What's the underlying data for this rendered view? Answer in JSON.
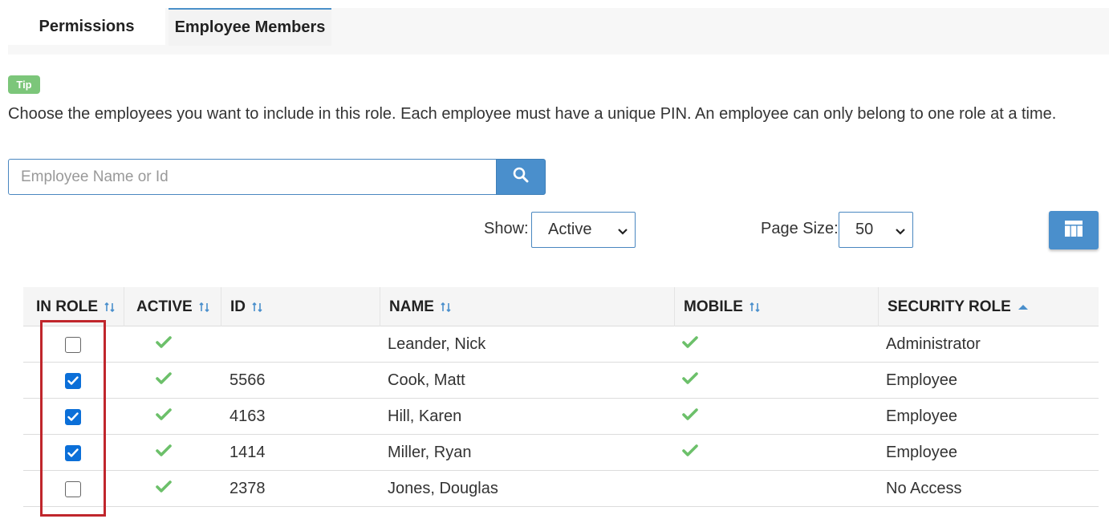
{
  "tabs": [
    {
      "label": "Permissions"
    },
    {
      "label": "Employee Members"
    }
  ],
  "tip": {
    "badge": "Tip",
    "text": "Choose the employees you want to include in this role. Each employee must have a unique PIN. An employee can only belong to one role at a time."
  },
  "search": {
    "placeholder": "Employee Name or Id",
    "value": "",
    "icon": "search-icon"
  },
  "filters": {
    "show_label": "Show:",
    "show_value": "Active",
    "page_size_label": "Page Size:",
    "page_size_value": "50"
  },
  "columns_button_icon": "grid-columns-icon",
  "table": {
    "headers": [
      "IN ROLE",
      "ACTIVE",
      "ID",
      "NAME",
      "MOBILE",
      "SECURITY ROLE"
    ],
    "sorted_column": "SECURITY ROLE",
    "sort_direction": "ascending",
    "rows": [
      {
        "in_role": false,
        "active": true,
        "id": "",
        "name": "Leander, Nick",
        "mobile": true,
        "security_role": "Administrator"
      },
      {
        "in_role": true,
        "active": true,
        "id": "5566",
        "name": "Cook, Matt",
        "mobile": true,
        "security_role": "Employee"
      },
      {
        "in_role": true,
        "active": true,
        "id": "4163",
        "name": "Hill, Karen",
        "mobile": true,
        "security_role": "Employee"
      },
      {
        "in_role": true,
        "active": true,
        "id": "1414",
        "name": "Miller, Ryan",
        "mobile": true,
        "security_role": "Employee"
      },
      {
        "in_role": false,
        "active": true,
        "id": "2378",
        "name": "Jones, Douglas",
        "mobile": false,
        "security_role": "No Access"
      }
    ]
  },
  "colors": {
    "accent": "#4a8fcc",
    "check_green": "#6cc06a",
    "checkbox_checked": "#0b6fd8",
    "highlight": "#c0262c"
  }
}
